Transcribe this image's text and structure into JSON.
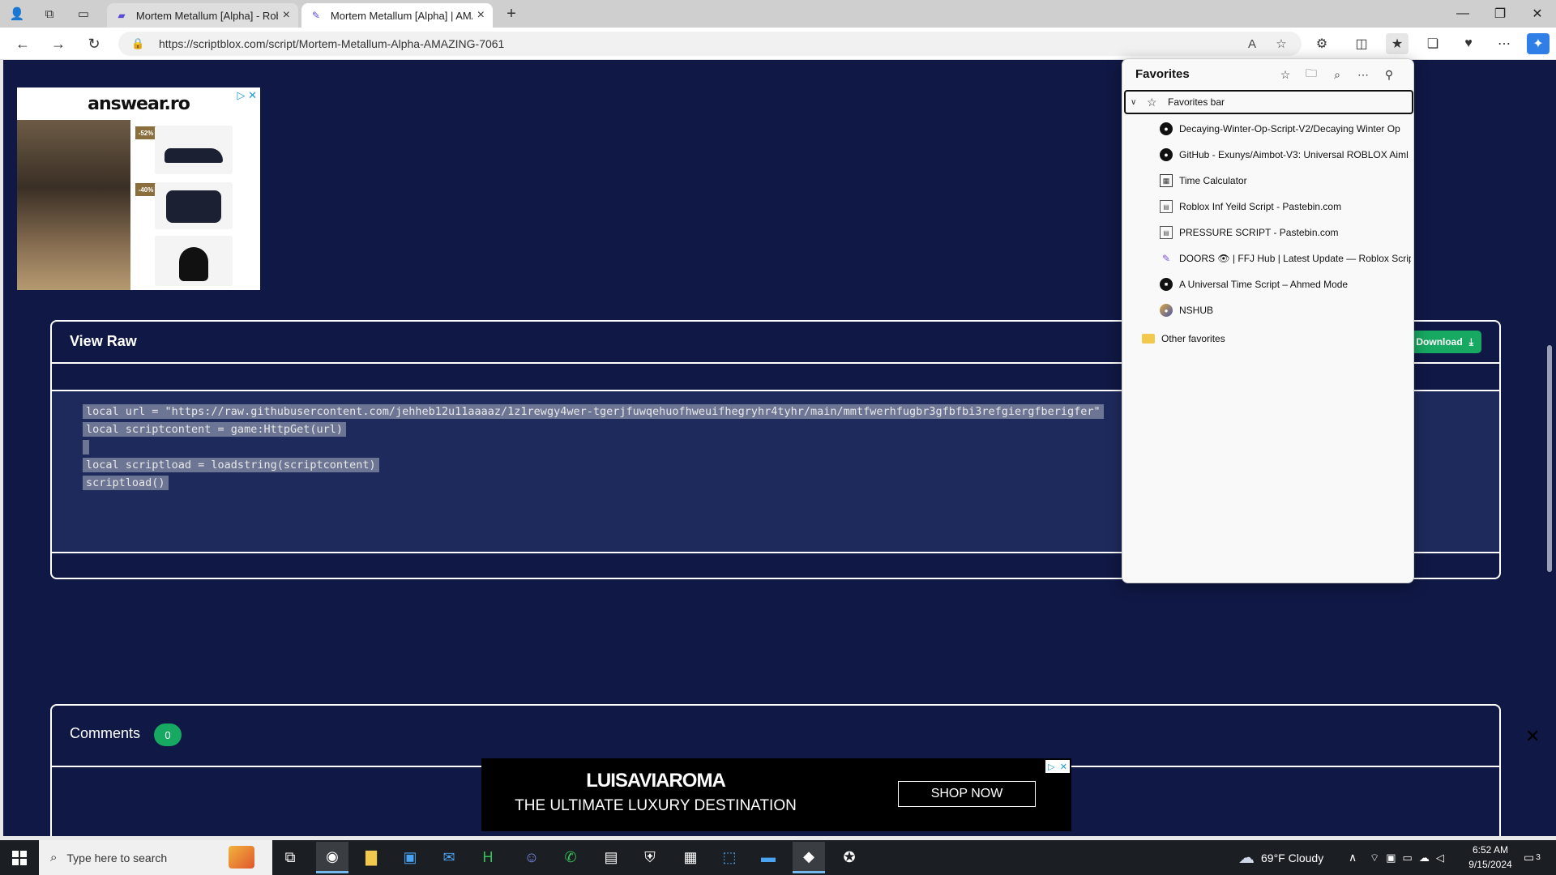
{
  "browser": {
    "tabs": [
      {
        "title": "Mortem Metallum [Alpha] - Roblo",
        "active": false
      },
      {
        "title": "Mortem Metallum [Alpha] | AMAZ",
        "active": true
      }
    ],
    "new_tab": "+",
    "address": {
      "url": "https://scriptblox.com/script/Mortem-Metallum-Alpha-AMAZING-7061"
    },
    "window_controls": {
      "minimize": "—",
      "restore": "❐",
      "close": "✕"
    }
  },
  "page": {
    "ad_top": {
      "brand": "answear.ro",
      "discounts": [
        "-52%",
        "-40%"
      ]
    },
    "raw_panel": {
      "title": "View Raw",
      "download_label": "Download",
      "code_lines": [
        "local url = \"https://raw.githubusercontent.com/jehheb12u11aaaaz/1z1rewgy4wer-tgerjfuwqehuofhweuifhegryhr4tyhr/main/mmtfwerhfugbr3gfbfbi3refgiergfberigfer\"",
        "local scriptcontent = game:HttpGet(url)",
        "",
        "local scriptload = loadstring(scriptcontent)",
        "scriptload()"
      ]
    },
    "comments_panel": {
      "title": "Comments",
      "count": "0"
    },
    "ad_bottom": {
      "brand": "LUISAVIAROMA",
      "tagline": "THE ULTIMATE LUXURY DESTINATION",
      "cta": "SHOP NOW"
    }
  },
  "favorites": {
    "title": "Favorites",
    "folder": "Favorites bar",
    "items": [
      {
        "label": "Decaying-Winter-Op-Script-V2/Decaying Winter Op",
        "icon": "github-icon"
      },
      {
        "label": "GitHub - Exunys/Aimbot-V3: Universal ROBLOX Aiml",
        "icon": "github-icon"
      },
      {
        "label": "Time Calculator",
        "icon": "calculator-icon"
      },
      {
        "label": "Roblox Inf Yeild Script - Pastebin.com",
        "icon": "pastebin-icon"
      },
      {
        "label": "PRESSURE SCRIPT - Pastebin.com",
        "icon": "pastebin-icon"
      },
      {
        "label": "DOORS 👁 | FFJ Hub | Latest Update — Roblox Scrip",
        "icon": "rscripts-icon"
      },
      {
        "label": "A Universal Time Script – Ahmed Mode",
        "icon": "ahmed-icon"
      },
      {
        "label": "NSHUB",
        "icon": "nshub-icon"
      }
    ],
    "other": "Other favorites"
  },
  "taskbar": {
    "search_placeholder": "Type here to search",
    "weather": "69°F  Cloudy",
    "time": "6:52 AM",
    "date": "9/15/2024",
    "notifications": "3"
  }
}
